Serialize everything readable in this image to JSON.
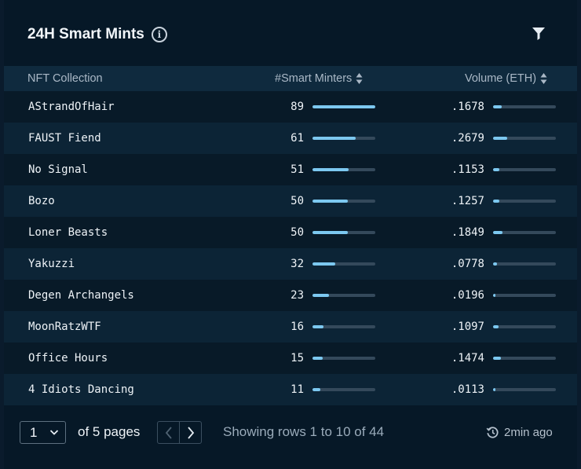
{
  "header": {
    "title": "24H Smart Mints",
    "info_icon": "info-circle-icon",
    "filter_icon": "filter-icon"
  },
  "table": {
    "columns": {
      "name": "NFT Collection",
      "minters": "#Smart Minters",
      "volume": "Volume (ETH)"
    },
    "bar_color": "#7cc8f0",
    "minters_max": 89,
    "volume_max": 12.0,
    "rows": [
      {
        "name": "AStrandOfHair",
        "minters": 89,
        "volume": ".1678"
      },
      {
        "name": "FAUST Fiend",
        "minters": 61,
        "volume": ".2679"
      },
      {
        "name": "No Signal",
        "minters": 51,
        "volume": ".1153"
      },
      {
        "name": "Bozo",
        "minters": 50,
        "volume": ".1257"
      },
      {
        "name": "Loner Beasts",
        "minters": 50,
        "volume": ".1849"
      },
      {
        "name": "Yakuzzi",
        "minters": 32,
        "volume": ".0778"
      },
      {
        "name": "Degen Archangels",
        "minters": 23,
        "volume": ".0196"
      },
      {
        "name": "MoonRatzWTF",
        "minters": 16,
        "volume": ".1097"
      },
      {
        "name": "Office Hours",
        "minters": 15,
        "volume": ".1474"
      },
      {
        "name": "4 Idiots Dancing",
        "minters": 11,
        "volume": ".0113"
      }
    ]
  },
  "footer": {
    "page_value": "1",
    "of_pages": "of 5 pages",
    "showing": "Showing rows 1 to 10 of 44",
    "updated": "2min ago"
  }
}
